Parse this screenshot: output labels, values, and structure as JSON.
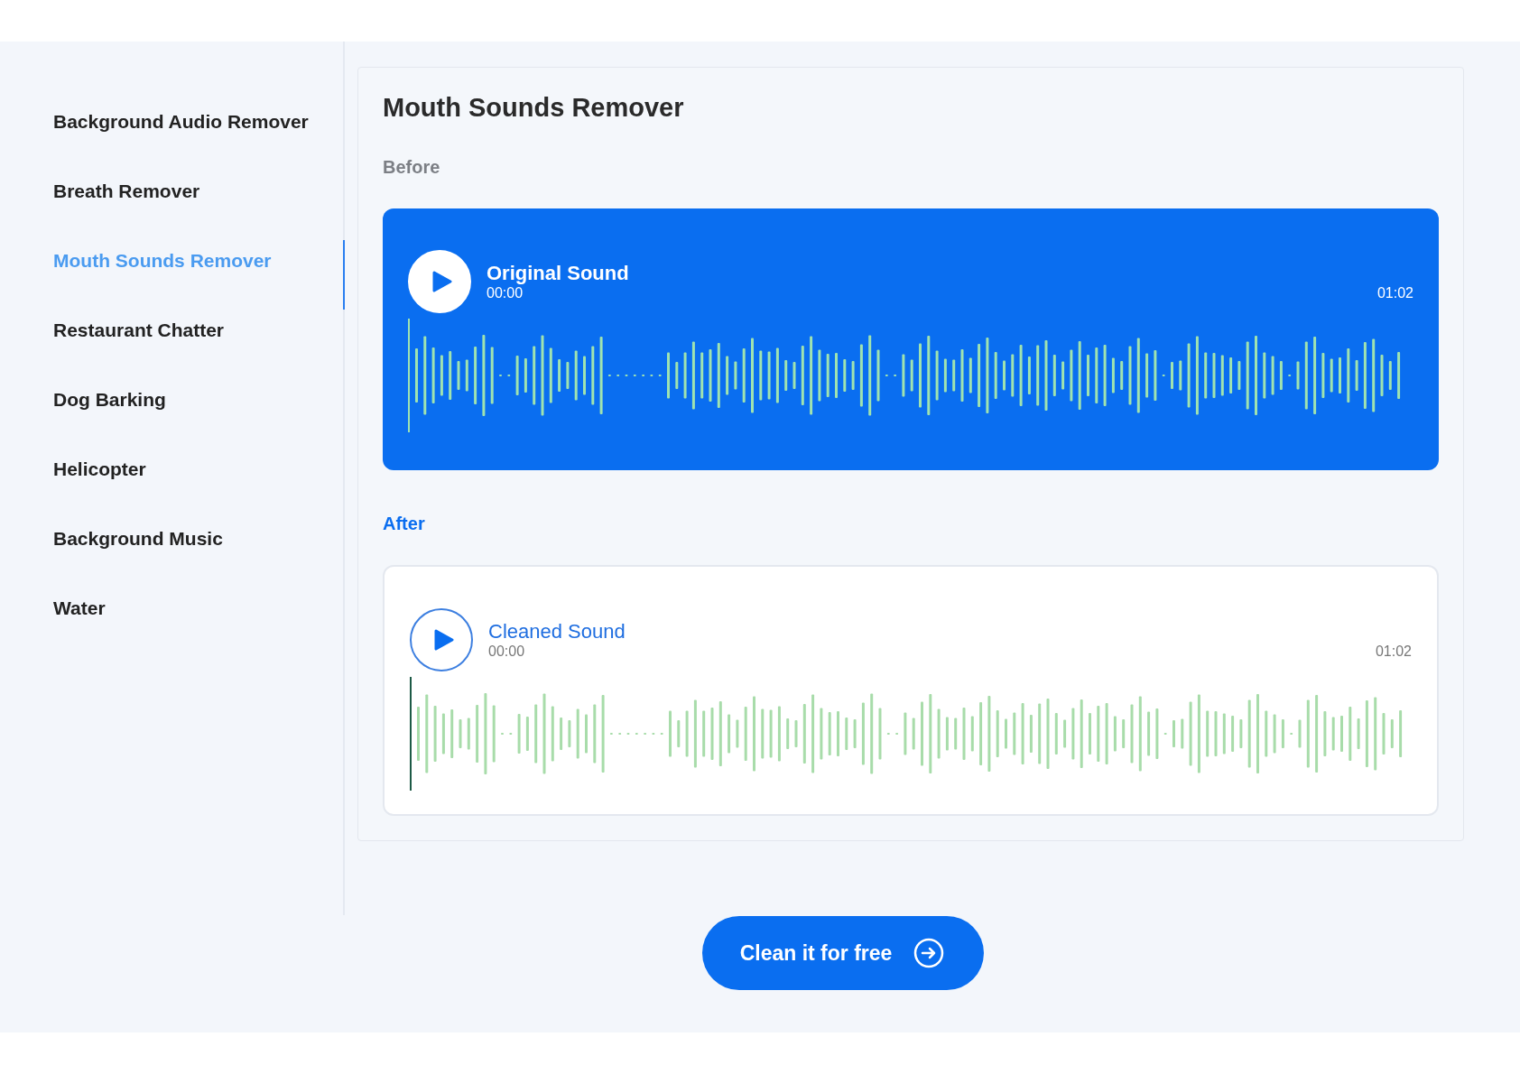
{
  "sidebar": {
    "items": [
      {
        "label": "Background Audio Remover",
        "selected": false
      },
      {
        "label": "Breath Remover",
        "selected": false
      },
      {
        "label": "Mouth Sounds Remover",
        "selected": true
      },
      {
        "label": "Restaurant Chatter",
        "selected": false
      },
      {
        "label": "Dog Barking",
        "selected": false
      },
      {
        "label": "Helicopter",
        "selected": false
      },
      {
        "label": "Background Music",
        "selected": false
      },
      {
        "label": "Water",
        "selected": false
      }
    ]
  },
  "panel": {
    "title": "Mouth Sounds Remover",
    "players": [
      {
        "section": "Before",
        "kind": "original",
        "title": "Original Sound",
        "current_time": "00:00",
        "duration": "01:02"
      },
      {
        "section": "After",
        "kind": "cleaned",
        "title": "Cleaned Sound",
        "current_time": "00:00",
        "duration": "01:02"
      }
    ]
  },
  "cta": {
    "label": "Clean it for free"
  }
}
